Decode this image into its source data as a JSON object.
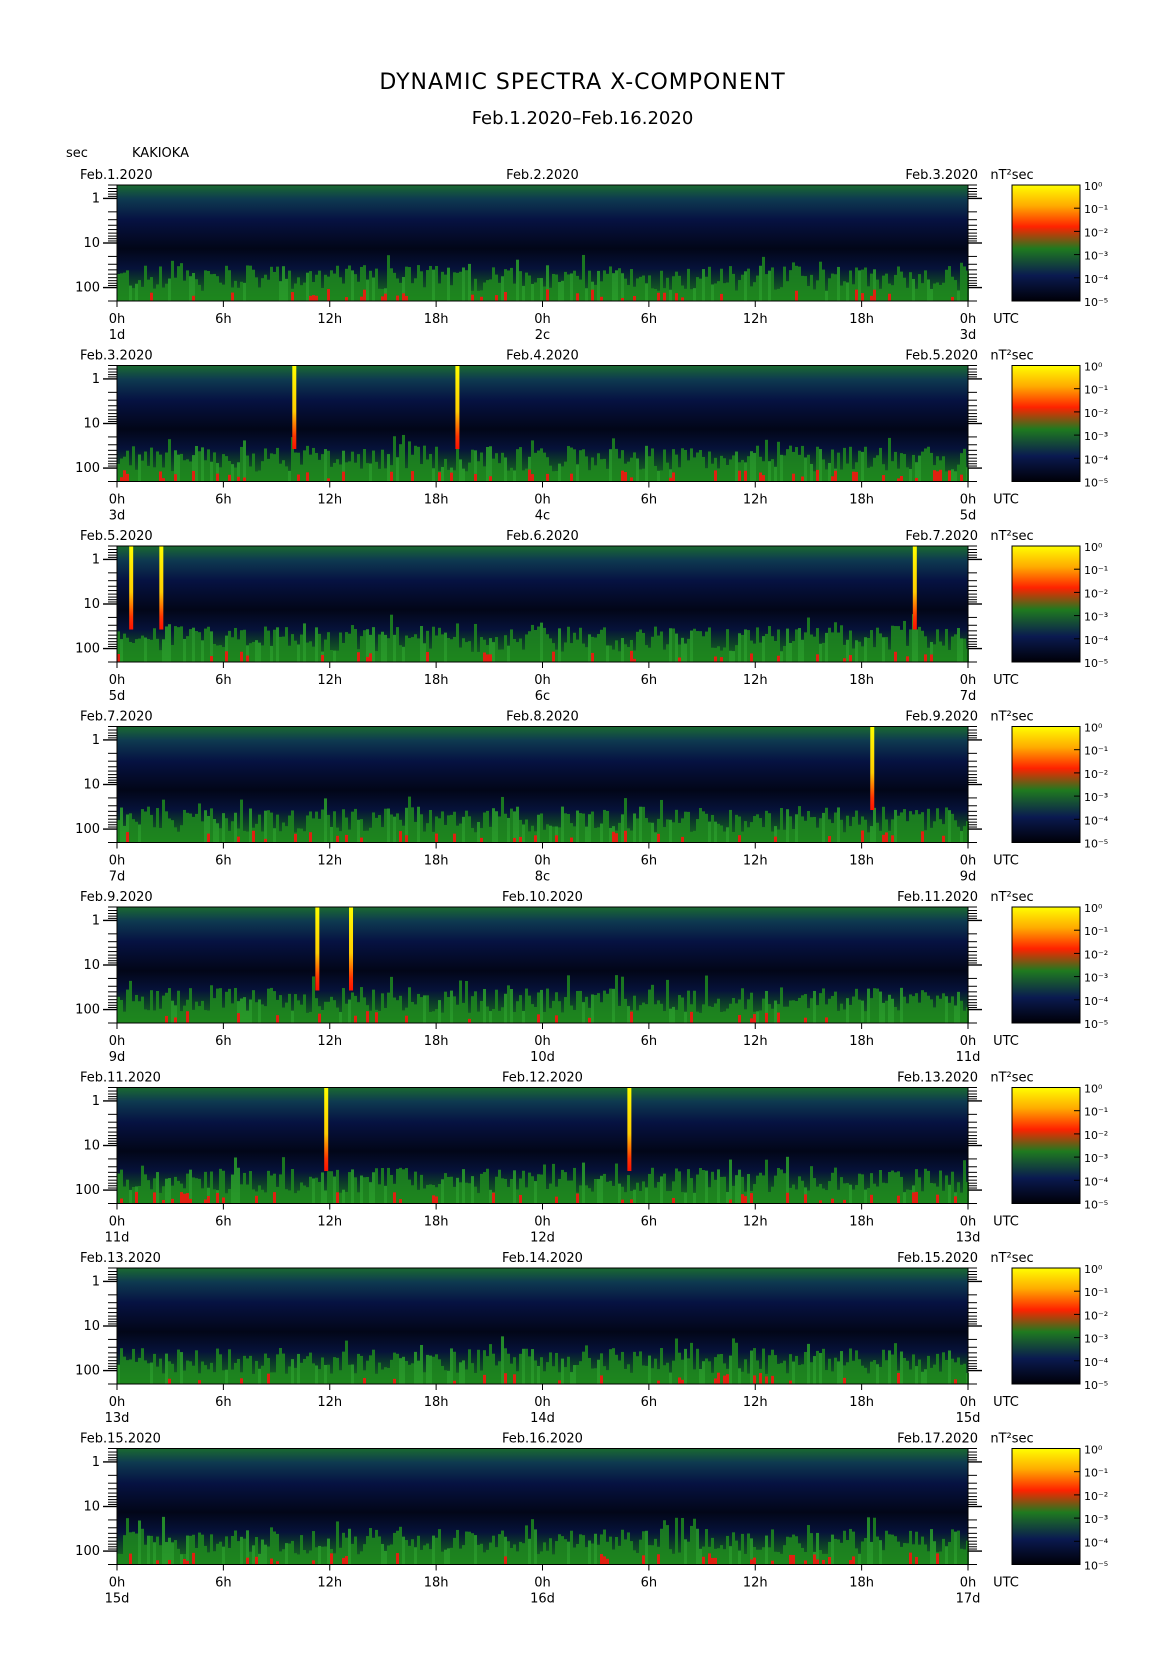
{
  "title": "DYNAMIC SPECTRA X-COMPONENT",
  "subtitle": "Feb.1.2020–Feb.16.2020",
  "unit_label": "sec",
  "station": "KAKIOKA",
  "colorbar_unit": "nT²sec",
  "colorbar_ticks": [
    "10⁰",
    "10⁻¹",
    "10⁻²",
    "10⁻³",
    "10⁻⁴",
    "10⁻⁵"
  ],
  "colorbar_colors": [
    "#ffff00",
    "#ff9900",
    "#ff0000",
    "#208020",
    "#0a1a50",
    "#000000"
  ],
  "y_ticks": [
    "1",
    "10",
    "100"
  ],
  "x_ticks": [
    "0h",
    "6h",
    "12h",
    "18h",
    "0h",
    "6h",
    "12h",
    "18h",
    "0h"
  ],
  "utc_label": "UTC",
  "chart_data": {
    "type": "heatmap",
    "title": "DYNAMIC SPECTRA X-COMPONENT",
    "ylabel": "sec",
    "y_axis": "period, log scale, 0.5–200 sec (decreasing downward)",
    "color_scale": "log power, 10⁻⁵ to 10⁰ nT²sec",
    "panels": [
      {
        "date_left": "Feb.1.2020",
        "date_mid": "Feb.2.2020",
        "date_right": "Feb.3.2020",
        "day_left": "1d",
        "day_mid": "2c",
        "day_right": "3d",
        "spikes": []
      },
      {
        "date_left": "Feb.3.2020",
        "date_mid": "Feb.4.2020",
        "date_right": "Feb.5.2020",
        "day_left": "3d",
        "day_mid": "4c",
        "day_right": "5d",
        "spikes": [
          10,
          19.2
        ]
      },
      {
        "date_left": "Feb.5.2020",
        "date_mid": "Feb.6.2020",
        "date_right": "Feb.7.2020",
        "day_left": "5d",
        "day_mid": "6c",
        "day_right": "7d",
        "spikes": [
          0.8,
          2.5,
          45
        ]
      },
      {
        "date_left": "Feb.7.2020",
        "date_mid": "Feb.8.2020",
        "date_right": "Feb.9.2020",
        "day_left": "7d",
        "day_mid": "8c",
        "day_right": "9d",
        "spikes": [
          42.6
        ]
      },
      {
        "date_left": "Feb.9.2020",
        "date_mid": "Feb.10.2020",
        "date_right": "Feb.11.2020",
        "day_left": "9d",
        "day_mid": "10d",
        "day_right": "11d",
        "spikes": [
          11.3,
          13.2
        ]
      },
      {
        "date_left": "Feb.11.2020",
        "date_mid": "Feb.12.2020",
        "date_right": "Feb.13.2020",
        "day_left": "11d",
        "day_mid": "12d",
        "day_right": "13d",
        "spikes": [
          11.8,
          28.9
        ]
      },
      {
        "date_left": "Feb.13.2020",
        "date_mid": "Feb.14.2020",
        "date_right": "Feb.15.2020",
        "day_left": "13d",
        "day_mid": "14d",
        "day_right": "15d",
        "spikes": []
      },
      {
        "date_left": "Feb.15.2020",
        "date_mid": "Feb.16.2020",
        "date_right": "Feb.17.2020",
        "day_left": "15d",
        "day_mid": "16d",
        "day_right": "17d",
        "spikes": []
      }
    ]
  }
}
